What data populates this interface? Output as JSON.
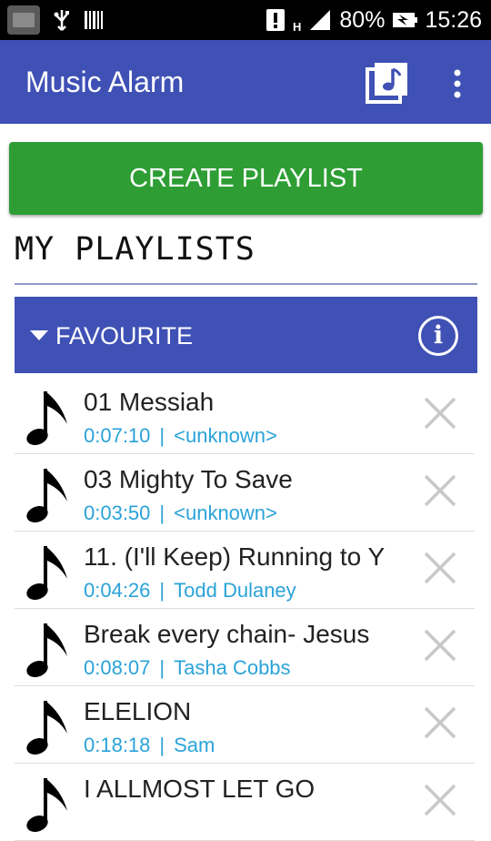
{
  "status_bar": {
    "battery_percent": "80%",
    "time": "15:26",
    "network": "H",
    "icons": [
      "app-thumbnail-icon",
      "usb-icon",
      "barcode-icon",
      "alert-icon",
      "signal-icon",
      "battery-charging-icon"
    ]
  },
  "app_bar": {
    "title": "Music Alarm",
    "actions": [
      "music-library-icon",
      "overflow-menu-icon"
    ],
    "color": "#3f51b5"
  },
  "create_button": {
    "label": "CREATE PLAYLIST",
    "color": "#2e9e34"
  },
  "section": {
    "title": "MY PLAYLISTS"
  },
  "playlist": {
    "name": "FAVOURITE",
    "info_icon": "info-icon",
    "songs": [
      {
        "title": "01 Messiah",
        "duration": "0:07:10",
        "separator": "|",
        "artist": "<unknown>"
      },
      {
        "title": "03 Mighty To Save",
        "duration": "0:03:50",
        "separator": "|",
        "artist": "<unknown>"
      },
      {
        "title": "11. (I'll Keep) Running to Y",
        "duration": "0:04:26",
        "separator": "|",
        "artist": "Todd Dulaney"
      },
      {
        "title": "Break every chain- Jesus",
        "duration": "0:08:07",
        "separator": "|",
        "artist": "Tasha Cobbs"
      },
      {
        "title": "ELELION",
        "duration": "0:18:18",
        "separator": "|",
        "artist": "Sam"
      },
      {
        "title": "I ALLMOST LET GO",
        "duration": "",
        "separator": "",
        "artist": ""
      }
    ]
  },
  "colors": {
    "meta_text": "#2aa3d8",
    "remove_icon": "#c8c8c8"
  }
}
